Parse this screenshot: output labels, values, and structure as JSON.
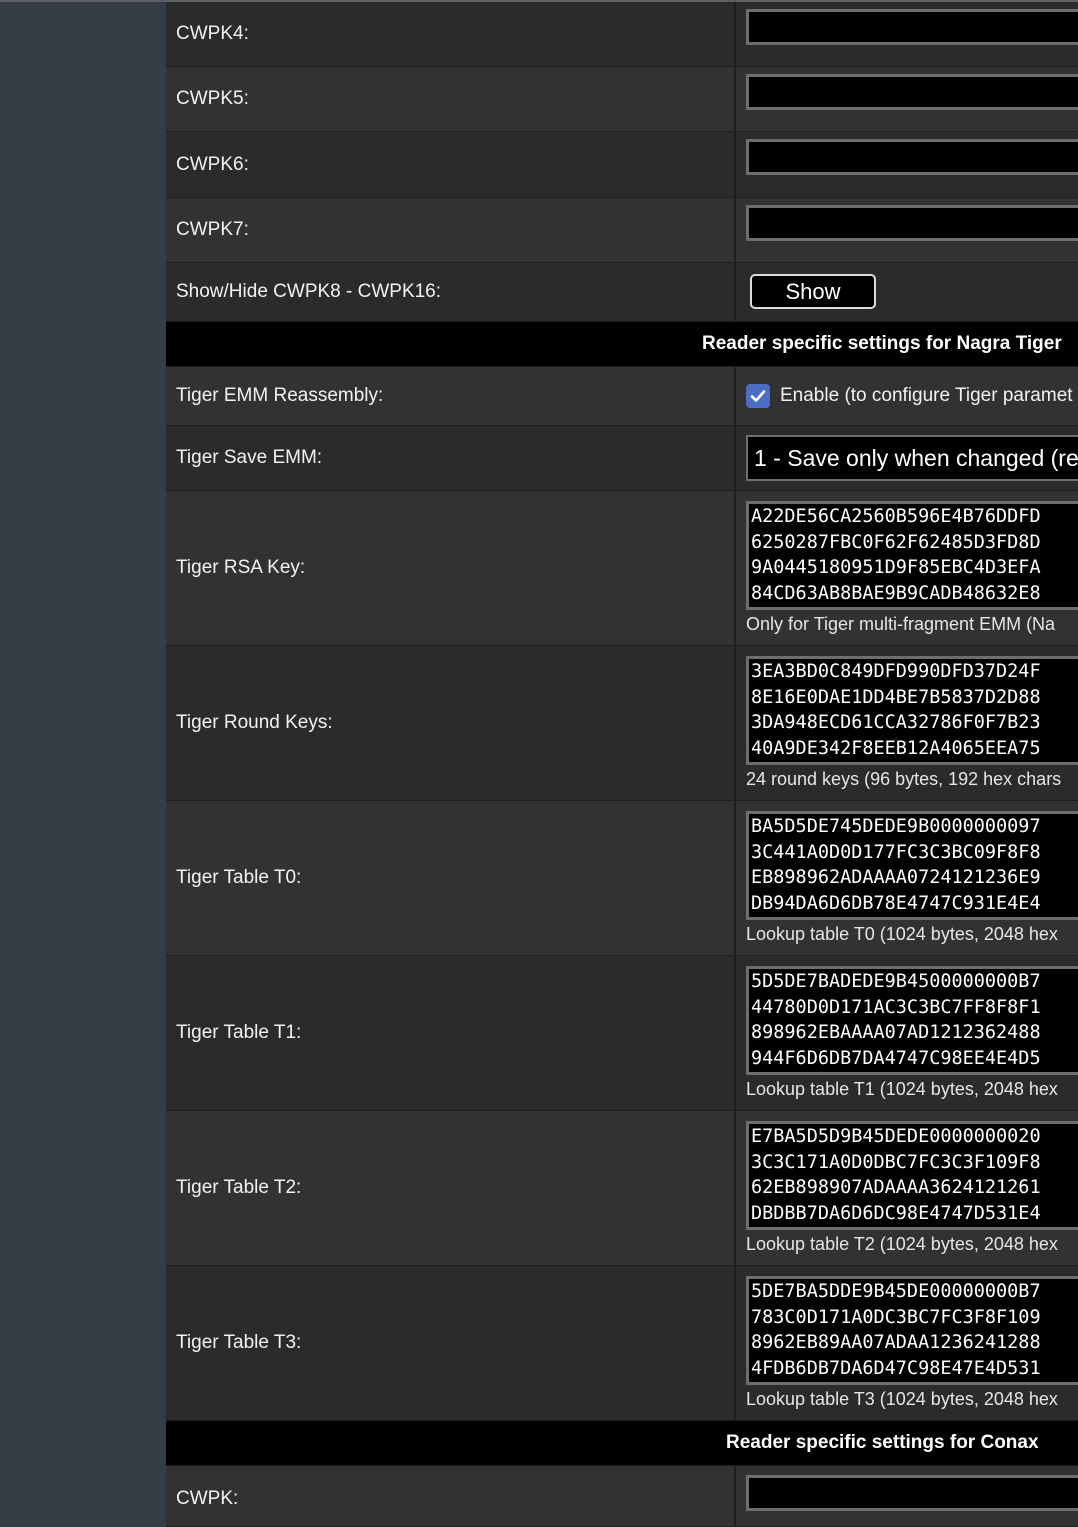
{
  "cwpk_fields": [
    {
      "label": "CWPK4:",
      "value": ""
    },
    {
      "label": "CWPK5:",
      "value": ""
    },
    {
      "label": "CWPK6:",
      "value": ""
    },
    {
      "label": "CWPK7:",
      "value": ""
    }
  ],
  "show_hide": {
    "label": "Show/Hide CWPK8 - CWPK16:",
    "button": "Show"
  },
  "sections": {
    "nagra_tiger": "Reader specific settings for Nagra Tiger",
    "conax": "Reader specific settings for Conax"
  },
  "tiger_emm_reassembly": {
    "label": "Tiger EMM Reassembly:",
    "checked": true,
    "option": "Enable (to configure Tiger paramet"
  },
  "tiger_save_emm": {
    "label": "Tiger Save EMM:",
    "selected": "1 - Save only when changed (re"
  },
  "tiger_rsa_key": {
    "label": "Tiger RSA Key:",
    "lines": [
      "A22DE56CA2560B596E4B76DDFD",
      "6250287FBC0F62F62485D3FD8D",
      "9A0445180951D9F85EBC4D3EFA",
      "84CD63AB8BAE9B9CADB48632E8"
    ],
    "hint": "Only for Tiger multi-fragment EMM (Na"
  },
  "tiger_round_keys": {
    "label": "Tiger Round Keys:",
    "lines": [
      "3EA3BD0C849DFD990DFD37D24F",
      "8E16E0DAE1DD4BE7B5837D2D88",
      "3DA948ECD61CCA32786F0F7B23",
      "40A9DE342F8EEB12A4065EEA75"
    ],
    "hint": "24 round keys (96 bytes, 192 hex chars"
  },
  "tiger_t0": {
    "label": "Tiger Table T0:",
    "lines": [
      "BA5D5DE745DEDE9B0000000097",
      "3C441A0D0D177FC3C3BC09F8F8",
      "EB898962ADAAAA0724121236E9",
      "DB94DA6D6DB78E4747C931E4E4"
    ],
    "hint": "Lookup table T0 (1024 bytes, 2048 hex"
  },
  "tiger_t1": {
    "label": "Tiger Table T1:",
    "lines": [
      "5D5DE7BADEDE9B4500000000B7",
      "44780D0D171AC3C3BC7FF8F8F1",
      "898962EBAAAA07AD1212362488",
      "944F6D6DB7DA4747C98EE4E4D5"
    ],
    "hint": "Lookup table T1 (1024 bytes, 2048 hex"
  },
  "tiger_t2": {
    "label": "Tiger Table T2:",
    "lines": [
      "E7BA5D5D9B45DEDE0000000020",
      "3C3C171A0D0DBC7FC3C3F109F8",
      "62EB898907ADAAAA3624121261",
      "DBDBB7DA6D6DC98E4747D531E4"
    ],
    "hint": "Lookup table T2 (1024 bytes, 2048 hex"
  },
  "tiger_t3": {
    "label": "Tiger Table T3:",
    "lines": [
      "5DE7BA5DDE9B45DE00000000B7",
      "783C0D171A0DC3BC7FC3F8F109",
      "8962EB89AA07ADAA1236241288",
      "4FDB6DB7DA6D47C98E47E4D531"
    ],
    "hint": "Lookup table T3 (1024 bytes, 2048 hex"
  },
  "conax_cwpk": {
    "label": "CWPK:"
  }
}
